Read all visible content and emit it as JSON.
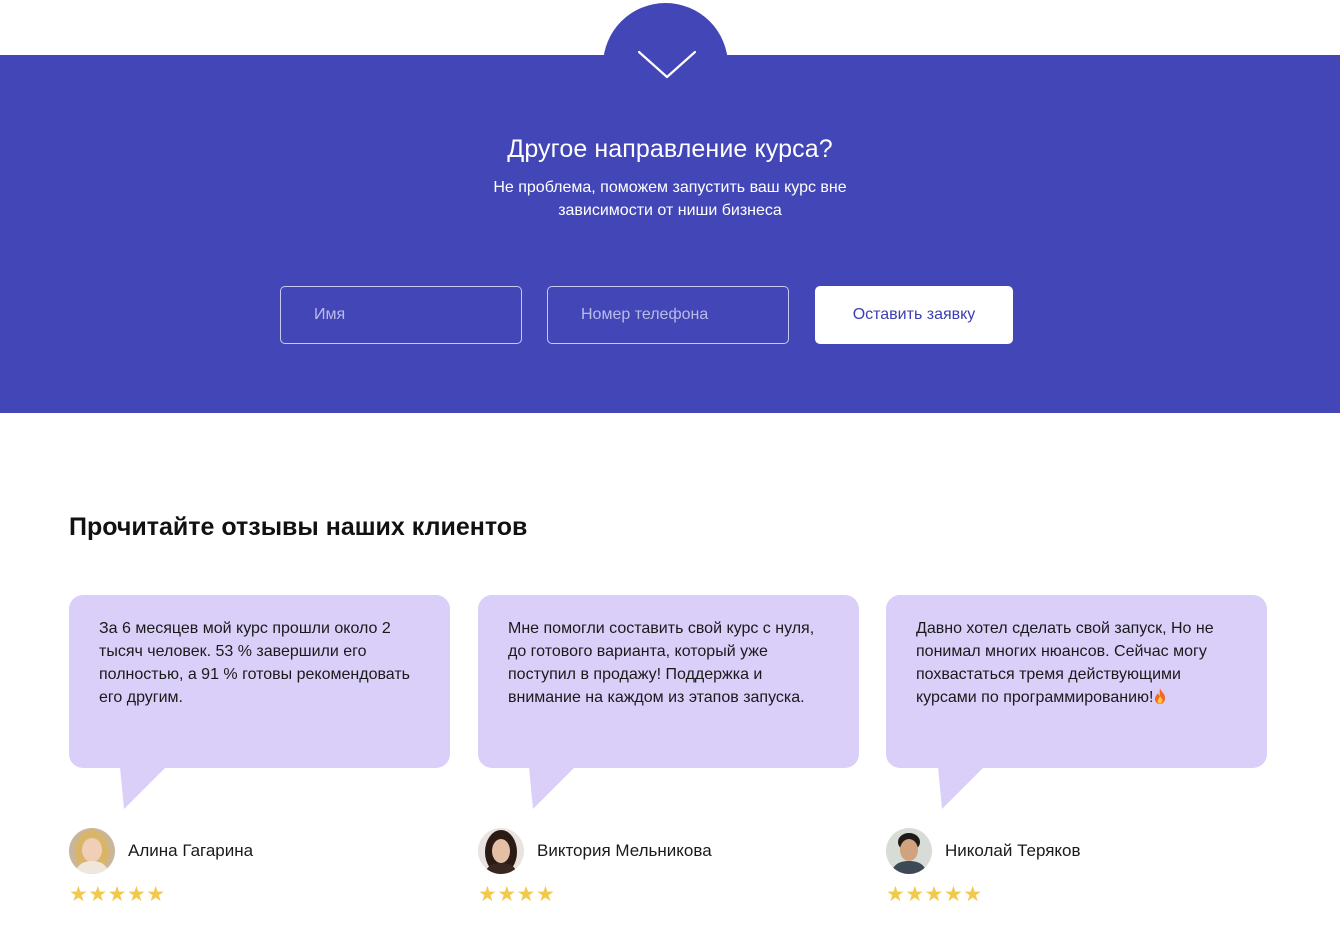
{
  "hero": {
    "title": "Другое направление курса?",
    "subtitle": "Не проблема, поможем запустить ваш курс вне зависимости от ниши бизнеса",
    "name_placeholder": "Имя",
    "phone_placeholder": "Номер телефона",
    "submit_label": "Оставить заявку",
    "scroll_icon": "chevron-down-icon"
  },
  "reviews": {
    "title": "Прочитайте отзывы наших клиентов",
    "items": [
      {
        "text": "За 6 месяцев мой курс прошли около 2 тысяч человек. 53 %  завершили его полностью, а 91 %  готовы рекомендовать его другим.",
        "author": "Алина Гагарина",
        "stars_text": "★★★★★",
        "rating": 5
      },
      {
        "text": "Мне помогли составить свой курс с нуля, до готового варианта, который уже поступил в продажу! Поддержка и внимание на каждом из этапов запуска.",
        "author": "Виктория Мельникова",
        "stars_text": "★★★★",
        "rating": 4
      },
      {
        "text": "Давно хотел сделать свой запуск, Но не понимал многих нюансов. Сейчас могу похвастаться тремя действующими курсами по программированию!",
        "author": "Николай Теряков",
        "stars_text": "★★★★★",
        "rating": 5,
        "emoji": "fire-icon"
      }
    ]
  },
  "colors": {
    "hero_bg": "#4346b6",
    "card_bg": "#dacff9",
    "star": "#f2c94c",
    "button_text": "#3b3fb0"
  }
}
